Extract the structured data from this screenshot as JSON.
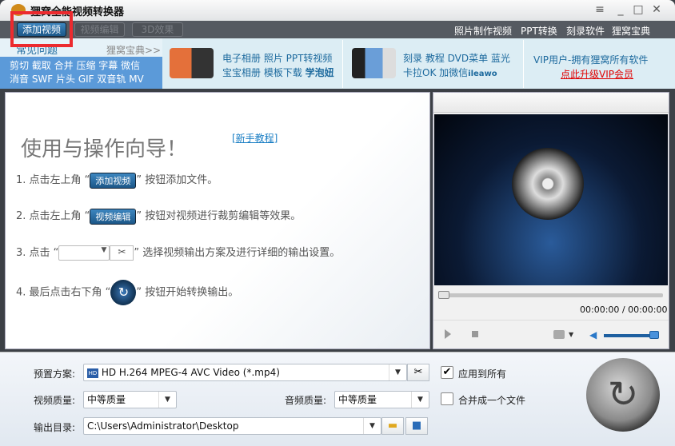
{
  "window": {
    "title": "狸窝全能视频转换器",
    "controls": [
      "menu",
      "minimize",
      "maximize",
      "close"
    ]
  },
  "toolbar": {
    "add_video": "添加视频",
    "edit_video": "视频编辑",
    "effect_3d": "3D效果",
    "links": [
      "照片制作视频",
      "PPT转换",
      "刻录软件",
      "狸窝宝典"
    ]
  },
  "banner": {
    "faq_title": "常见问题",
    "faq_more": "狸窝宝典>>",
    "faq_line1": "剪切 截取 合并 压缩 字幕 微信",
    "faq_line2": "消音 SWF 片头 GIF 双音轨 MV",
    "ad1_line1": "电子相册 照片 PPT转视频",
    "ad1_line2a": "宝宝相册 模板下载 ",
    "ad1_line2b": "学泡妞",
    "ad2_line1": "刻录 教程 DVD菜单 蓝光",
    "ad2_line2a": "卡拉OK 加微信",
    "ad2_line2b": "ileawo",
    "vip_line": "VIP用户-拥有狸窝所有软件",
    "vip_link": "点此升级VIP会员"
  },
  "guide": {
    "title": "使用与操作向导！",
    "tutorial_link": "[新手教程]",
    "step1_pre": "1. 点击左上角 “",
    "step1_btn": "添加视频",
    "step1_post": "” 按钮添加文件。",
    "step2_pre": "2. 点击左上角 “",
    "step2_btn": "视频编辑",
    "step2_post": "” 按钮对视频进行裁剪编辑等效果。",
    "step3_pre": "3. 点击 “",
    "step3_post": "” 选择视频输出方案及进行详细的输出设置。",
    "step4_pre": "4. 最后点击右下角 “",
    "step4_post": "” 按钮开始转换输出。"
  },
  "player": {
    "time": "00:00:00 / 00:00:00",
    "seek_progress": 0,
    "volume": 1.0
  },
  "settings": {
    "preset_label": "预置方案:",
    "preset_value": "HD H.264 MPEG-4 AVC Video (*.mp4)",
    "apply_all_label": "应用到所有",
    "apply_all_checked": true,
    "video_quality_label": "视频质量:",
    "video_quality_value": "中等质量",
    "audio_quality_label": "音频质量:",
    "audio_quality_value": "中等质量",
    "merge_label": "合并成一个文件",
    "merge_checked": false,
    "output_label": "输出目录:",
    "output_value": "C:\\Users\\Administrator\\Desktop"
  },
  "colors": {
    "accent": "#1c5788",
    "highlight_box": "#ec2a2e",
    "vip_link": "#e00000"
  }
}
